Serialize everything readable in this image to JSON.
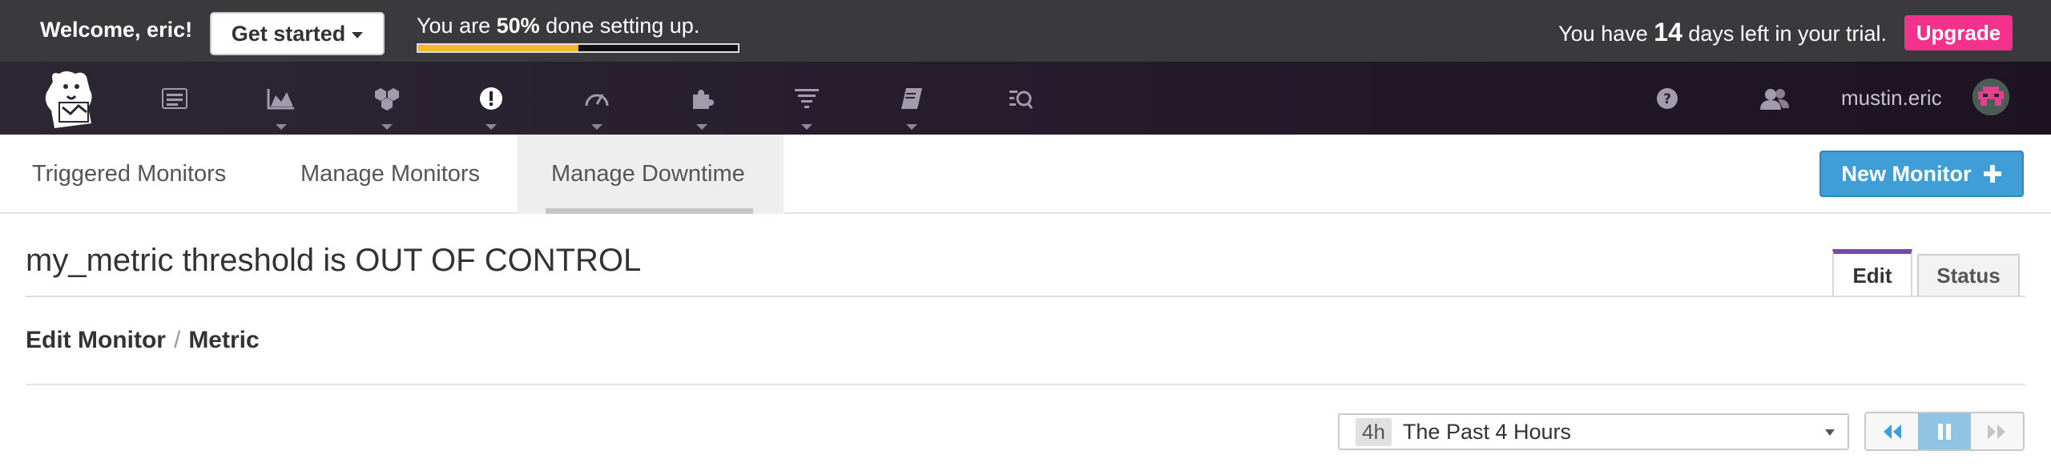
{
  "onboarding": {
    "welcome": "Welcome, eric!",
    "get_started": "Get started",
    "setup_prefix": "You are",
    "setup_percent": "50%",
    "setup_suffix": "done setting up.",
    "progress_fraction": 0.5,
    "trial_prefix": "You have",
    "trial_days": "14",
    "trial_suffix": "days left in your trial.",
    "upgrade": "Upgrade"
  },
  "nav": {
    "items": [
      {
        "icon": "datadog-logo"
      },
      {
        "icon": "events-icon"
      },
      {
        "icon": "dashboards-icon"
      },
      {
        "icon": "infrastructure-icon"
      },
      {
        "icon": "monitors-icon"
      },
      {
        "icon": "apm-gauge-icon"
      },
      {
        "icon": "integrations-puzzle-icon"
      },
      {
        "icon": "logs-filter-icon"
      },
      {
        "icon": "notebooks-icon"
      },
      {
        "icon": "synthetics-icon"
      },
      {
        "icon": "help-icon"
      },
      {
        "icon": "team-icon"
      }
    ],
    "username": "mustin.eric"
  },
  "tabs": {
    "items": [
      "Triggered Monitors",
      "Manage Monitors",
      "Manage Downtime"
    ],
    "active": "Manage Downtime",
    "new_monitor": "New Monitor"
  },
  "monitor": {
    "title": "my_metric threshold is OUT OF CONTROL",
    "edit_tab": "Edit",
    "status_tab": "Status"
  },
  "breadcrumb": {
    "part1": "Edit Monitor",
    "separator": "/",
    "part2": "Metric"
  },
  "time": {
    "badge": "4h",
    "label": "The Past 4 Hours"
  },
  "colors": {
    "upgrade": "#f5318e",
    "progress": "#f5b731",
    "new_monitor": "#3f9ed5",
    "edit_accent": "#774aa4"
  }
}
